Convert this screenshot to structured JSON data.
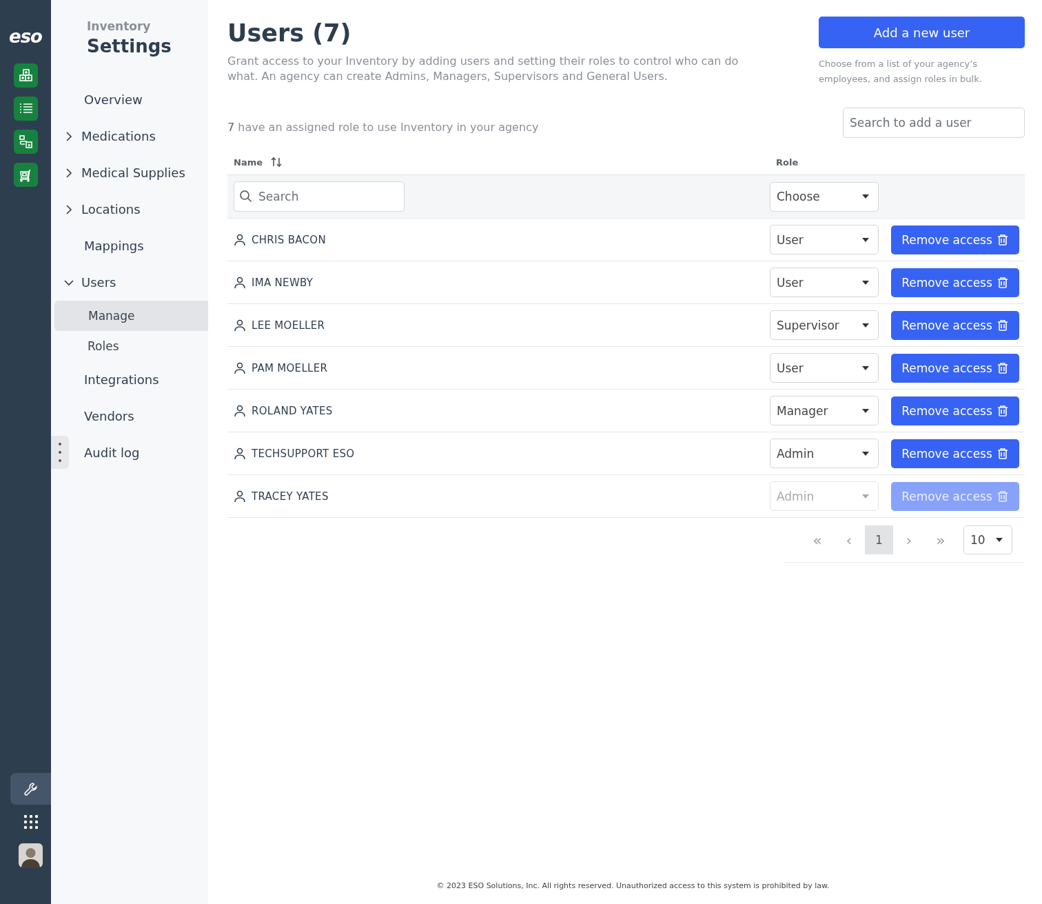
{
  "rail": {
    "logo": "eso",
    "apps": [
      {
        "kind": "boxes"
      },
      {
        "kind": "list"
      },
      {
        "kind": "flow"
      },
      {
        "kind": "cart"
      }
    ],
    "bottom": [
      {
        "kind": "settings",
        "selected": true
      },
      {
        "kind": "apps",
        "selected": false
      },
      {
        "kind": "avatar",
        "selected": false
      }
    ]
  },
  "nav": {
    "subtitle": "Inventory",
    "title": "Settings",
    "items": [
      {
        "label": "Overview",
        "kind": "link"
      },
      {
        "label": "Medications",
        "kind": "group",
        "expanded": false
      },
      {
        "label": "Medical Supplies",
        "kind": "group",
        "expanded": false
      },
      {
        "label": "Locations",
        "kind": "group",
        "expanded": false
      },
      {
        "label": "Mappings",
        "kind": "link"
      },
      {
        "label": "Users",
        "kind": "group",
        "expanded": true,
        "children": [
          {
            "label": "Manage",
            "selected": true
          },
          {
            "label": "Roles",
            "selected": false
          }
        ]
      },
      {
        "label": "Integrations",
        "kind": "link"
      },
      {
        "label": "Vendors",
        "kind": "link"
      },
      {
        "label": "Audit log",
        "kind": "link"
      }
    ]
  },
  "header": {
    "title": "Users (7)",
    "description": "Grant access to your Inventory by adding users and setting their roles to control who can do what. An agency can create Admins, Managers, Supervisors and General Users.",
    "add_button": "Add a new user",
    "add_hint": "Choose from a list of your agency’s employees, and assign roles in bulk."
  },
  "add_search": {
    "placeholder": "Search to add a user"
  },
  "summary": "**7** have an assigned role to use Inventory in your agency",
  "table": {
    "columns": [
      "Name",
      "Role"
    ],
    "filters": {
      "name_placeholder": "Search",
      "role_placeholder": "Choose"
    },
    "rows": [
      {
        "name": "CHRIS BACON",
        "role": "User",
        "action": "Remove access",
        "disabled": false
      },
      {
        "name": "IMA NEWBY",
        "role": "User",
        "action": "Remove access",
        "disabled": false
      },
      {
        "name": "LEE MOELLER",
        "role": "Supervisor",
        "action": "Remove access",
        "disabled": false
      },
      {
        "name": "PAM MOELLER",
        "role": "User",
        "action": "Remove access",
        "disabled": false
      },
      {
        "name": "ROLAND YATES",
        "role": "Manager",
        "action": "Remove access",
        "disabled": false
      },
      {
        "name": "TECHSUPPORT ESO",
        "role": "Admin",
        "action": "Remove access",
        "disabled": false
      },
      {
        "name": "TRACEY YATES",
        "role": "Admin",
        "action": "Remove access",
        "disabled": true
      }
    ]
  },
  "pagination": {
    "first": "«",
    "prev": "‹",
    "next": "›",
    "last": "»",
    "pages": [
      {
        "label": "1",
        "selected": true
      }
    ],
    "page_size": "10"
  },
  "footer": "© 2023 ESO Solutions, Inc. All rights reserved. Unauthorized access to this system is prohibited by law."
}
